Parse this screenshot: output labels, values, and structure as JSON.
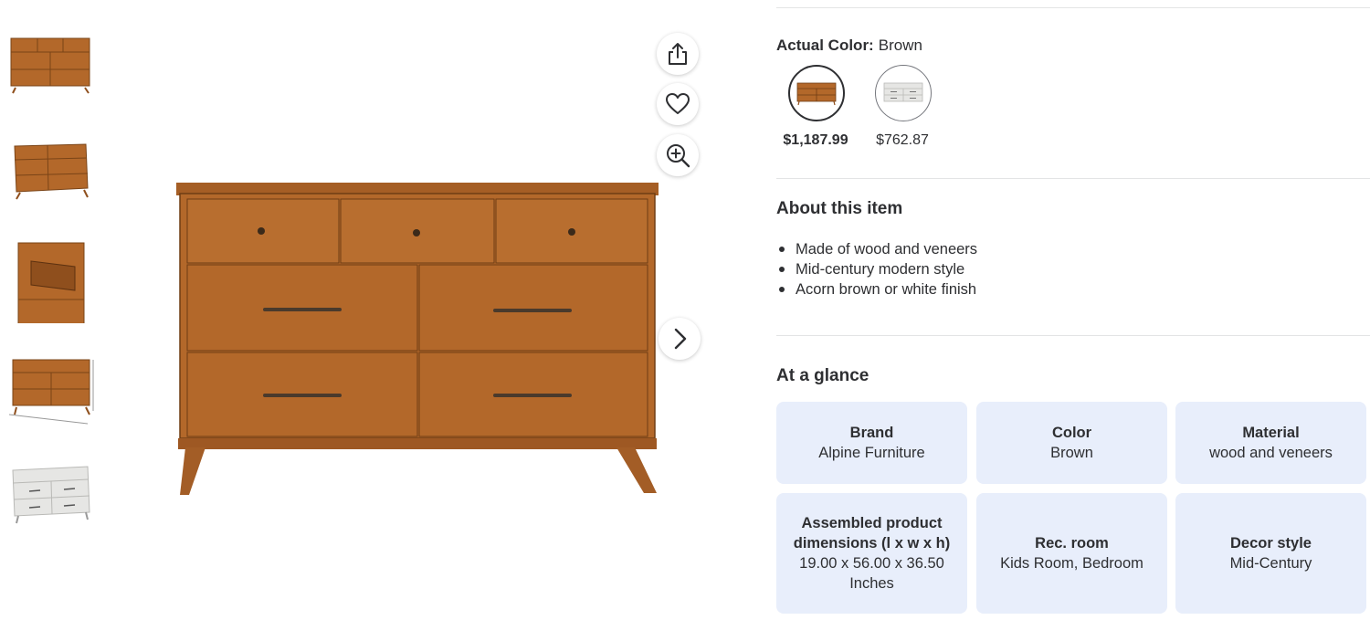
{
  "thumbnails": [
    {
      "name": "dresser-front-view",
      "finish": "brown"
    },
    {
      "name": "dresser-angle-view",
      "finish": "brown"
    },
    {
      "name": "dresser-open-drawer-view",
      "finish": "brown"
    },
    {
      "name": "dresser-dimension-view",
      "finish": "brown"
    },
    {
      "name": "dresser-white-view",
      "finish": "white"
    }
  ],
  "icons": {
    "share": "share-icon",
    "favorite": "heart-icon",
    "zoom": "zoom-in-icon",
    "next": "chevron-right-icon"
  },
  "color_selector": {
    "label": "Actual Color:",
    "value": "Brown",
    "options": [
      {
        "name": "Brown",
        "price": "$1,187.99",
        "selected": true
      },
      {
        "name": "White",
        "price": "$762.87",
        "selected": false
      }
    ]
  },
  "about": {
    "title": "About this item",
    "bullets": [
      "Made of wood and veneers",
      "Mid-century modern style",
      "Acorn brown or white finish"
    ]
  },
  "glance": {
    "title": "At a glance",
    "cards": [
      {
        "label": "Brand",
        "value": "Alpine Furniture"
      },
      {
        "label": "Color",
        "value": "Brown"
      },
      {
        "label": "Material",
        "value": "wood and veneers"
      },
      {
        "label": "Assembled product dimensions (l x w x h)",
        "value": "19.00 x 56.00 x 36.50 Inches"
      },
      {
        "label": "Rec. room",
        "value": "Kids Room, Bedroom"
      },
      {
        "label": "Decor style",
        "value": "Mid-Century"
      }
    ]
  },
  "colors": {
    "wood": "#b3682a",
    "wood_dark": "#8f4f1d",
    "white_finish": "#e6e6e4",
    "card_bg": "#e8eefb",
    "text": "#2e2f32"
  }
}
